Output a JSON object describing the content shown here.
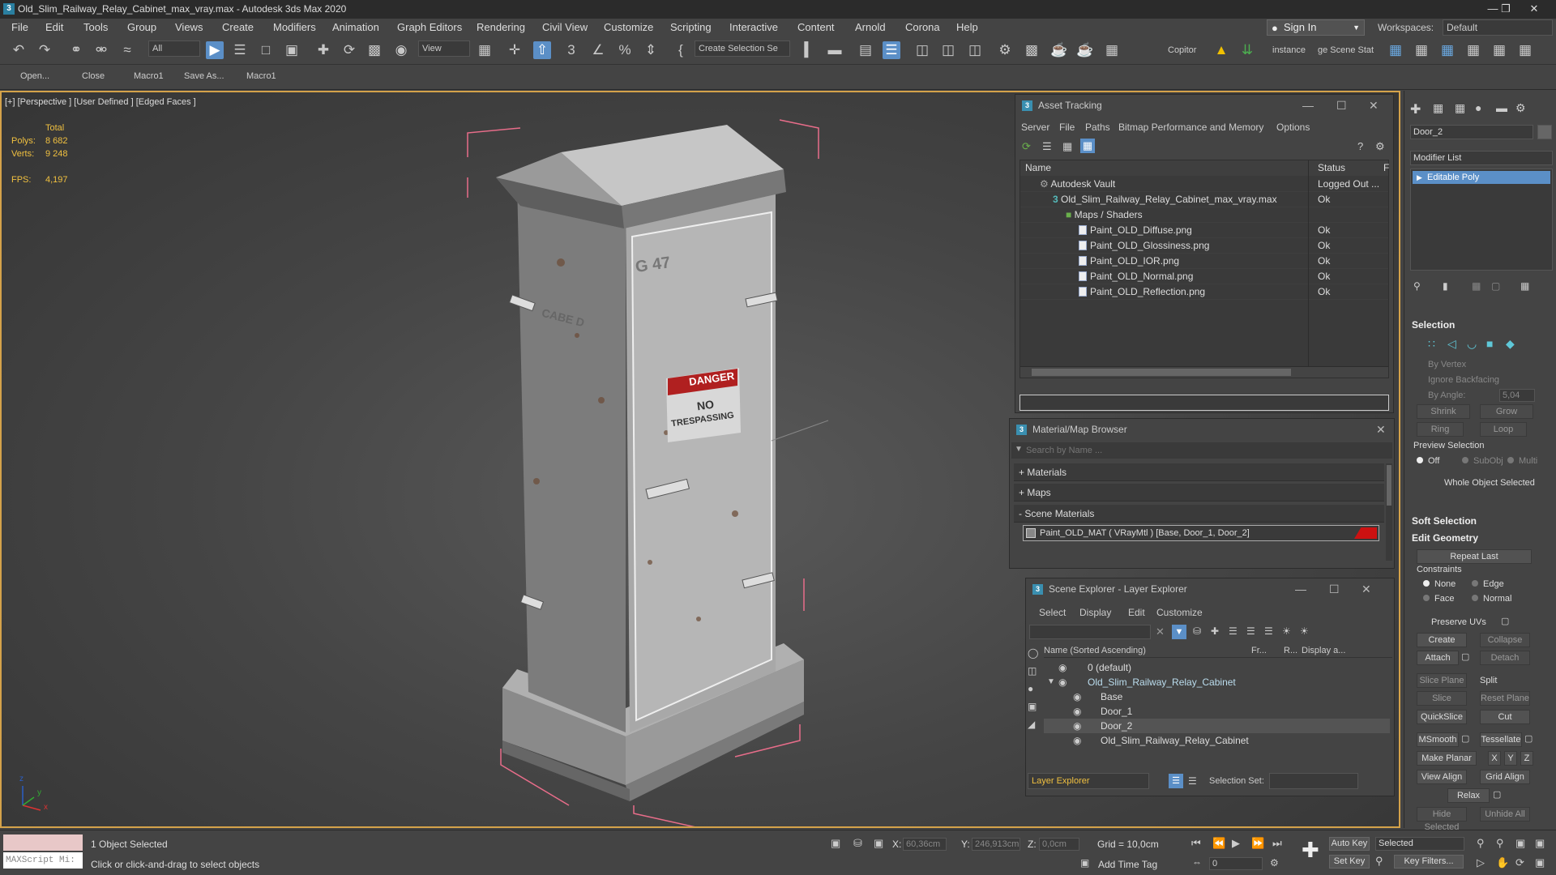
{
  "window": {
    "title": "Old_Slim_Railway_Relay_Cabinet_max_vray.max - Autodesk 3ds Max 2020",
    "app_icon": "3"
  },
  "menu": [
    "File",
    "Edit",
    "Tools",
    "Group",
    "Views",
    "Create",
    "Modifiers",
    "Animation",
    "Graph Editors",
    "Rendering",
    "Civil View",
    "Customize",
    "Scripting",
    "Interactive",
    "Content",
    "Arnold",
    "Corona",
    "Help"
  ],
  "account": {
    "sign_in": "Sign In",
    "workspaces_label": "Workspaces:",
    "workspace": "Default"
  },
  "toolbar": {
    "filter_dropdown": "All",
    "ref_coord_dropdown": "View",
    "selection_set_dropdown": "Create Selection Se",
    "copitor": "Copitor",
    "instance": "instance",
    "scene_stat": "ge Scene Stat"
  },
  "command_bar": [
    "Open...",
    "Close",
    "Macro1",
    "Save As...",
    "Macro1"
  ],
  "viewport": {
    "label": "[+] [Perspective ] [User Defined ] [Edged Faces ]",
    "stats": {
      "total_label": "Total",
      "polys_label": "Polys:",
      "polys": "8 682",
      "verts_label": "Verts:",
      "verts": "9 248",
      "fps_label": "FPS:",
      "fps": "4,197"
    },
    "sign_text_1": "DANGER",
    "sign_text_2": "NO",
    "sign_text_3": "TRESPASSING",
    "cabinet_text_1": "G 47",
    "cabinet_text_2": "CABE D",
    "gizmo_axes": {
      "x": "x",
      "y": "y",
      "z": "z"
    }
  },
  "asset_tracking": {
    "title": "Asset Tracking",
    "menu": [
      "Server",
      "File",
      "Paths",
      "Bitmap Performance and Memory",
      "Options"
    ],
    "columns": [
      "Name",
      "Status",
      "F"
    ],
    "rows": [
      {
        "name": "Autodesk Vault",
        "status": "Logged Out ..."
      },
      {
        "name": "Old_Slim_Railway_Relay_Cabinet_max_vray.max",
        "status": "Ok"
      },
      {
        "name": "Maps / Shaders",
        "status": ""
      },
      {
        "name": "Paint_OLD_Diffuse.png",
        "status": "Ok"
      },
      {
        "name": "Paint_OLD_Glossiness.png",
        "status": "Ok"
      },
      {
        "name": "Paint_OLD_IOR.png",
        "status": "Ok"
      },
      {
        "name": "Paint_OLD_Normal.png",
        "status": "Ok"
      },
      {
        "name": "Paint_OLD_Reflection.png",
        "status": "Ok"
      }
    ]
  },
  "material_browser": {
    "title": "Material/Map Browser",
    "search_placeholder": "Search by Name ...",
    "sections": [
      "+ Materials",
      "+ Maps",
      "- Scene Materials"
    ],
    "scene_material": "Paint_OLD_MAT  ( VRayMtl )  [Base, Door_1, Door_2]",
    "swatch_color": "#cc1111"
  },
  "scene_explorer": {
    "title": "Scene Explorer - Layer Explorer",
    "menu": [
      "Select",
      "Display",
      "Edit",
      "Customize"
    ],
    "columns": [
      "Name (Sorted Ascending)",
      "Fr...",
      "R...",
      "Display a..."
    ],
    "rows": [
      {
        "name": "0 (default)"
      },
      {
        "name": "Old_Slim_Railway_Relay_Cabinet"
      },
      {
        "name": "Base"
      },
      {
        "name": "Door_1"
      },
      {
        "name": "Door_2"
      },
      {
        "name": "Old_Slim_Railway_Relay_Cabinet"
      }
    ],
    "explorer_dropdown": "Layer Explorer",
    "selection_set_label": "Selection Set:"
  },
  "command_panel": {
    "object_name": "Door_2",
    "modifier_list": "Modifier List",
    "modifier": "Editable Poly",
    "selection_header": "Selection",
    "by_vertex": "By Vertex",
    "ignore_backfacing": "Ignore Backfacing",
    "by_angle": "By Angle:",
    "by_angle_value": "5,04",
    "shrink": "Shrink",
    "grow": "Grow",
    "ring": "Ring",
    "loop": "Loop",
    "preview_selection": "Preview Selection",
    "off": "Off",
    "subobj": "SubObj",
    "multi": "Multi",
    "whole_object": "Whole Object Selected",
    "soft_selection": "Soft Selection",
    "edit_geometry": "Edit Geometry",
    "repeat_last": "Repeat Last",
    "constraints": "Constraints",
    "none": "None",
    "edge": "Edge",
    "face": "Face",
    "normal": "Normal",
    "preserve_uvs": "Preserve UVs",
    "create": "Create",
    "collapse": "Collapse",
    "attach": "Attach",
    "detach": "Detach",
    "slice_plane": "Slice Plane",
    "split": "Split",
    "slice": "Slice",
    "reset_plane": "Reset Plane",
    "quickslice": "QuickSlice",
    "cut": "Cut",
    "msmooth": "MSmooth",
    "tessellate": "Tessellate",
    "make_planar": "Make Planar",
    "x": "X",
    "y": "Y",
    "z": "Z",
    "view_align": "View Align",
    "grid_align": "Grid Align",
    "relax": "Relax",
    "hide_selected": "Hide Selected",
    "unhide_all": "Unhide All"
  },
  "status": {
    "maxscript": "MAXScript Mi:",
    "selected": "1 Object Selected",
    "hint": "Click or click-and-drag to select objects",
    "x_label": "X:",
    "x": "60,36cm",
    "y_label": "Y:",
    "y": "246,913cm",
    "z_label": "Z:",
    "z": "0,0cm",
    "grid": "Grid = 10,0cm",
    "add_time_tag": "Add Time Tag",
    "auto_key": "Auto Key",
    "set_key": "Set Key",
    "selected_dd": "Selected",
    "key_filters": "Key Filters...",
    "frame": "0"
  }
}
